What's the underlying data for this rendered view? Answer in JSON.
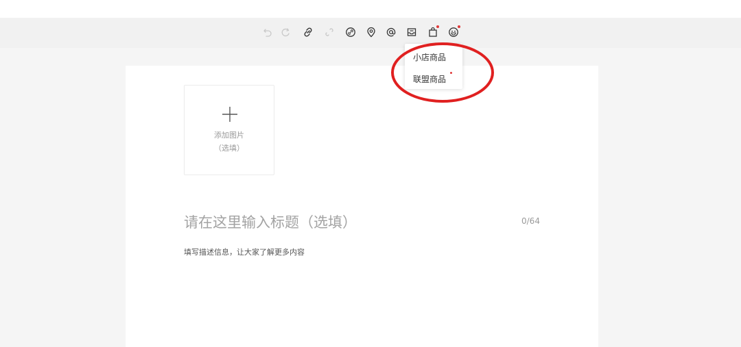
{
  "toolbar": {
    "tools": [
      "undo-icon",
      "redo-icon",
      "link-icon",
      "unlink-icon",
      "product-link-icon",
      "location-icon",
      "mention-icon",
      "inbox-icon",
      "shopping-bag-icon",
      "emoji-icon"
    ],
    "accent_dot_color": "#e03a3a"
  },
  "product_menu": {
    "items": [
      {
        "label": "小店商品"
      },
      {
        "label": "联盟商品"
      }
    ],
    "highlight_color": "#e02020"
  },
  "editor": {
    "image_upload": {
      "add_label": "添加图片",
      "optional_label": "（选填）"
    },
    "title": {
      "placeholder": "请在这里输入标题（选填）",
      "counter": "0/64"
    },
    "description": {
      "placeholder": "填写描述信息，让大家了解更多内容"
    }
  }
}
